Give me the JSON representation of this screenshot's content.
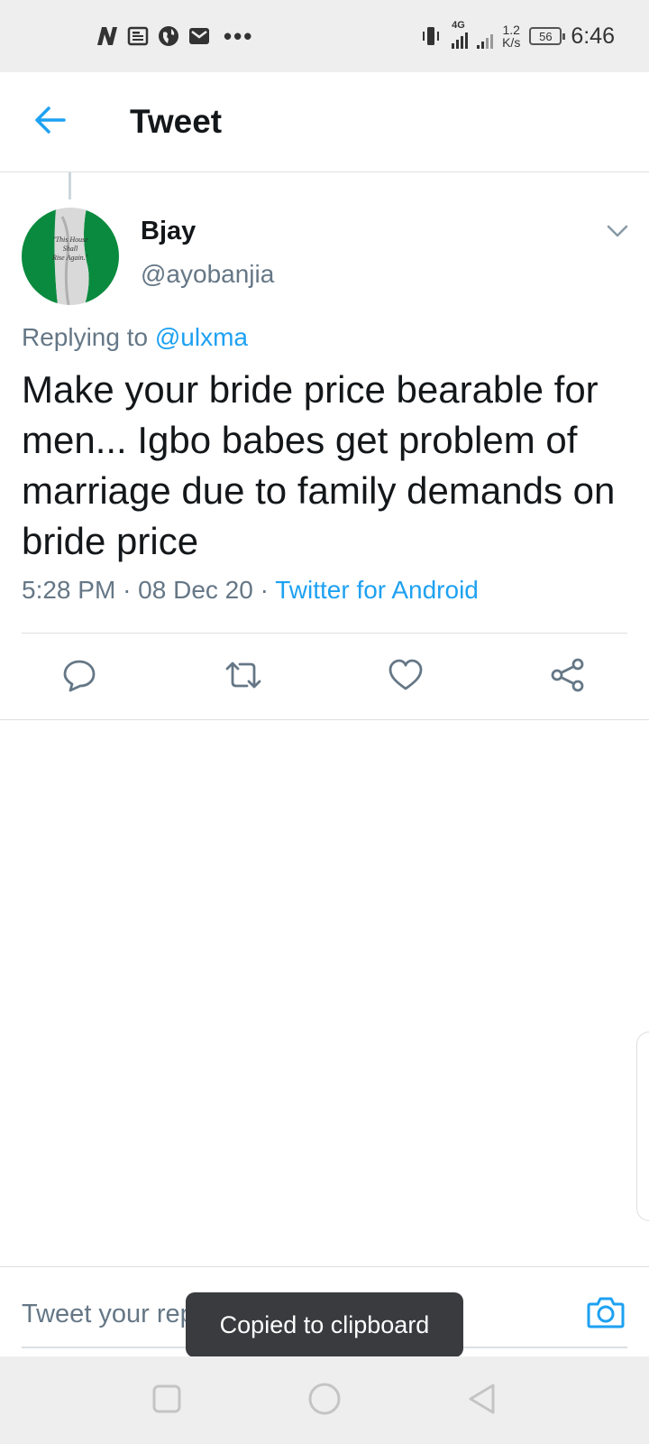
{
  "status_bar": {
    "network": "4G",
    "speed_value": "1.2",
    "speed_unit": "K/s",
    "battery": "56",
    "time": "6:46",
    "icons": [
      "n-app-icon",
      "news-icon",
      "globe-icon",
      "mail-icon",
      "more-dots-icon",
      "vibrate-icon",
      "signal-icon",
      "battery-icon"
    ]
  },
  "header": {
    "title": "Tweet"
  },
  "tweet": {
    "author_name": "Bjay",
    "author_handle": "@ayobanjia",
    "avatar_text": "This House Shall Rise Again",
    "replying_prefix": "Replying to",
    "replying_to": "@ulxma",
    "text": "Make your bride price bearable for men... Igbo babes get problem of marriage due to family demands on bride price",
    "time": "5:28 PM",
    "date": "08 Dec 20",
    "source": "Twitter for Android"
  },
  "actions": [
    "reply-icon",
    "retweet-icon",
    "like-icon",
    "share-icon"
  ],
  "reply_bar": {
    "placeholder": "Tweet your reply"
  },
  "toast": {
    "message": "Copied to clipboard"
  },
  "colors": {
    "accent": "#1da1f2",
    "secondary_text": "#657786",
    "primary_text": "#14171a",
    "divider": "#dcdfe2",
    "toast_bg": "#3a3b3f",
    "system_bar": "#eeeeee"
  }
}
